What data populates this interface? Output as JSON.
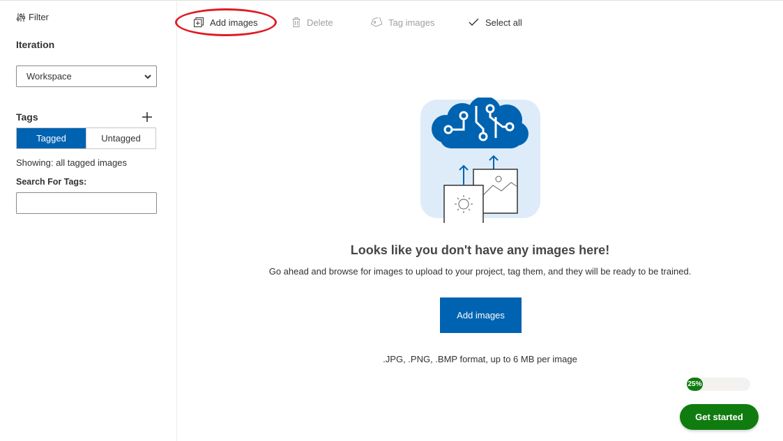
{
  "sidebar": {
    "filter_label": "Filter",
    "iteration_label": "Iteration",
    "iteration_selected": "Workspace",
    "tags_label": "Tags",
    "toggle": {
      "tagged": "Tagged",
      "untagged": "Untagged",
      "active": "Tagged"
    },
    "showing_text": "Showing: all tagged images",
    "search_label": "Search For Tags:",
    "search_value": ""
  },
  "toolbar": {
    "add_images": "Add images",
    "delete": "Delete",
    "tag_images": "Tag images",
    "select_all": "Select all"
  },
  "empty_state": {
    "title": "Looks like you don't have any images here!",
    "description": "Go ahead and browse for images to upload to your project, tag them, and they will be ready to be trained.",
    "button_label": "Add images",
    "formats": ".JPG, .PNG, .BMP format, up to 6 MB per image"
  },
  "progress": {
    "percent": 25,
    "label": "25%"
  },
  "cta": {
    "label": "Get started"
  },
  "colors": {
    "accent_blue": "#0063b1",
    "success_green": "#107c10",
    "highlight_red": "#e01b24",
    "disabled_text": "#a19f9d"
  },
  "icons": {
    "filter": "filter-sliders-icon",
    "dropdown": "chevron-down-icon",
    "add_tag": "plus-icon",
    "add_images": "add-image-icon",
    "delete": "trash-icon",
    "tag_images": "tag-icon",
    "select_all": "checkmark-icon"
  }
}
